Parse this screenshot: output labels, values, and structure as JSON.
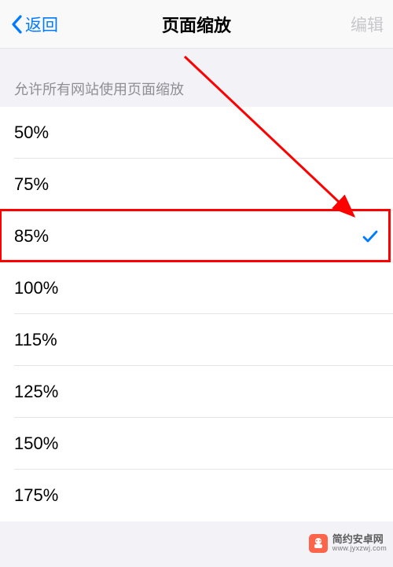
{
  "header": {
    "back_label": "返回",
    "title": "页面缩放",
    "edit_label": "编辑"
  },
  "section": {
    "header": "允许所有网站使用页面缩放"
  },
  "zoom_options": [
    {
      "label": "50%",
      "selected": false
    },
    {
      "label": "75%",
      "selected": false
    },
    {
      "label": "85%",
      "selected": true
    },
    {
      "label": "100%",
      "selected": false
    },
    {
      "label": "115%",
      "selected": false
    },
    {
      "label": "125%",
      "selected": false
    },
    {
      "label": "150%",
      "selected": false
    },
    {
      "label": "175%",
      "selected": false
    }
  ],
  "annotation": {
    "highlight_index": 2
  },
  "watermark": {
    "name": "简约安卓网",
    "url": "www.jyxzwj.com"
  }
}
